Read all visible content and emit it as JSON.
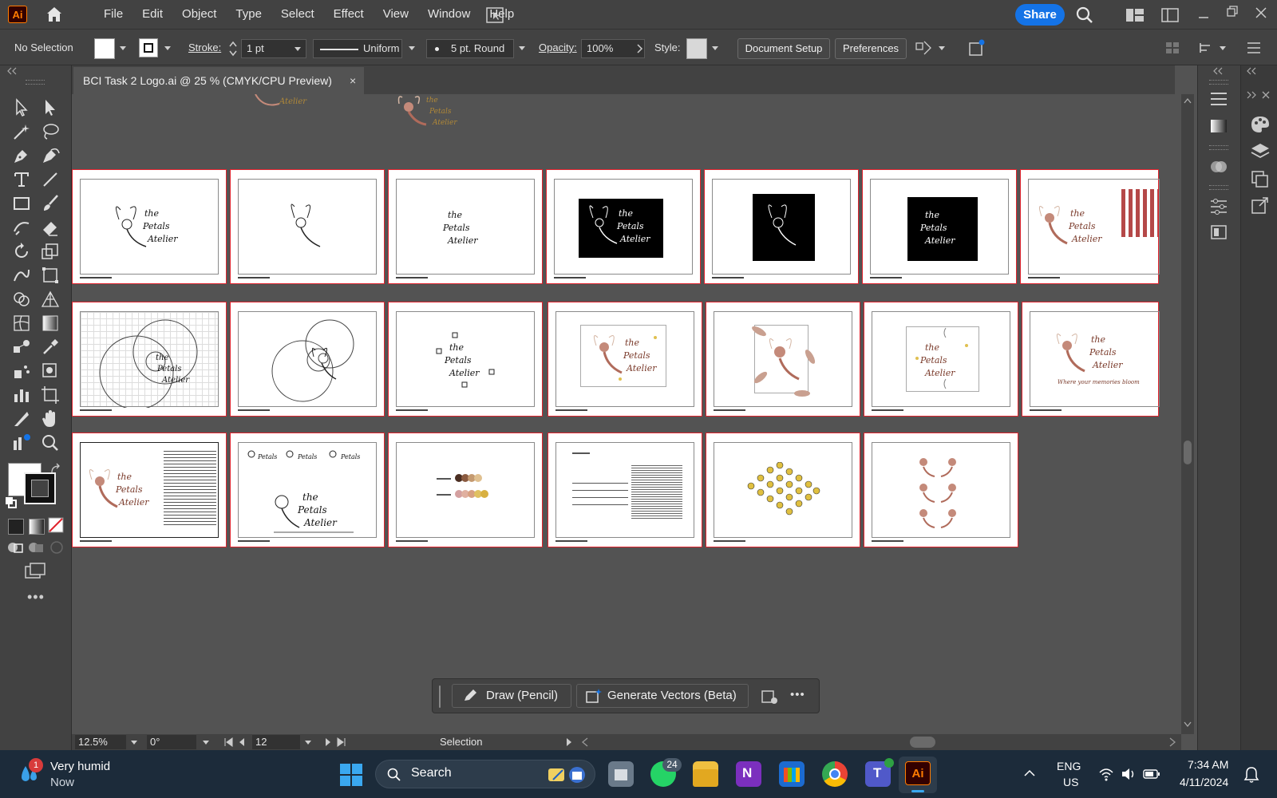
{
  "app": {
    "logo": "Ai",
    "menus": [
      "File",
      "Edit",
      "Object",
      "Type",
      "Select",
      "Effect",
      "View",
      "Window",
      "Help"
    ],
    "share_label": "Share"
  },
  "control_bar": {
    "selection_status": "No Selection",
    "stroke_label": "Stroke:",
    "stroke_weight": "1 pt",
    "stroke_profile": "Uniform",
    "brush": "5 pt. Round",
    "opacity_label": "Opacity:",
    "opacity_value": "100%",
    "style_label": "Style:",
    "document_setup_label": "Document Setup",
    "preferences_label": "Preferences"
  },
  "document": {
    "tab_title": "BCI Task 2 Logo.ai @ 25 % (CMYK/CPU Preview)",
    "close_glyph": "×"
  },
  "artboards": {
    "row1": [
      "logo-full",
      "fairy-outline",
      "wordmark",
      "logo-on-black",
      "fairy-on-black",
      "wordmark-on-black",
      "color-palette"
    ],
    "row2": [
      "grid-construction",
      "circle-construction",
      "wordmark-sparkles",
      "color-logo-frame",
      "fairy-petals",
      "wordmark-frame",
      "logo-tagline"
    ],
    "row3": [
      "logo-with-text",
      "size-variations",
      "color-swatches",
      "letter-document",
      "pattern-stars",
      "pattern-fairies"
    ],
    "tagline": "Where your memories bloom",
    "wordmark_lines": [
      "the",
      "Petals",
      "Atelier"
    ]
  },
  "contextual_bar": {
    "draw_label": "Draw (Pencil)",
    "generate_label": "Generate Vectors (Beta)",
    "more_glyph": "•••"
  },
  "status_bar": {
    "zoom": "12.5%",
    "rotation": "0°",
    "artboard_number": "12",
    "tool_name": "Selection"
  },
  "taskbar": {
    "weather_title": "Very humid",
    "weather_sub": "Now",
    "weather_badge": "1",
    "search_placeholder": "Search",
    "whatsapp_badge": "24",
    "lang_line1": "ENG",
    "lang_line2": "US",
    "time": "7:34 AM",
    "date": "4/11/2024"
  },
  "colors": {
    "accent": "#1473e6",
    "artboard_border": "#e0232d",
    "ai_orange": "#ff7c00"
  }
}
